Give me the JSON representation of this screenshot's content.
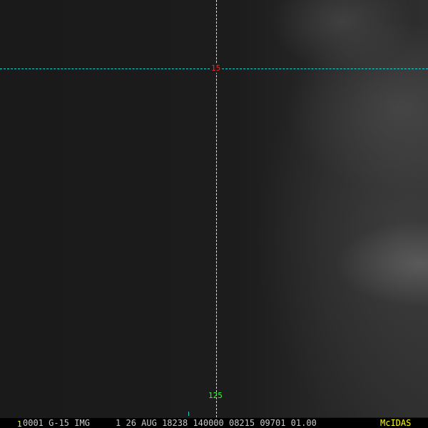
{
  "overlay": {
    "latitude_label": "15",
    "longitude_label": "125"
  },
  "status_bar": {
    "frame_number": "1",
    "info_text": "0001 G-15 IMG     1 26 AUG 18238 140000 08215 09701 01.00",
    "logo": "McIDAS"
  },
  "colors": {
    "grid_lat": "#19d3d3",
    "grid_lon": "#dddddd",
    "lat_label": "#ff2020",
    "lon_label": "#30ff30",
    "logo": "#ffff00"
  }
}
